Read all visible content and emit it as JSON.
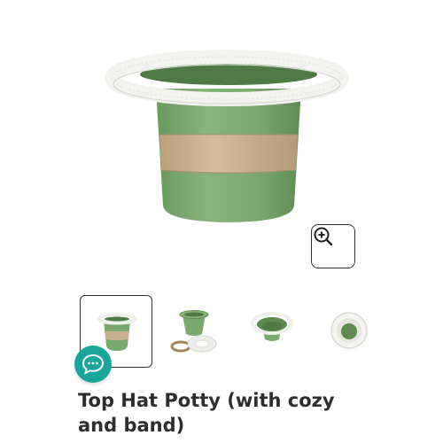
{
  "product": {
    "title": "Top Hat Potty (with cozy and band)",
    "image_alt": "Top Hat Potty with white cozy and tan band"
  },
  "gallery": {
    "selected_index": 0,
    "thumbnails": [
      {
        "alt": "Top Hat Potty front view"
      },
      {
        "alt": "Potty with band and cozy"
      },
      {
        "alt": "Potty angled view"
      },
      {
        "alt": "Potty top view"
      }
    ]
  },
  "icons": {
    "zoom": "zoom-in-icon",
    "chat": "chat-bubble-icon"
  },
  "colors": {
    "potty_green": "#78a86b",
    "band_tan": "#c9b28f",
    "cozy_white": "#f2f2ee",
    "chat_teal": "#1aa59c",
    "title_text": "#2d2d2d"
  }
}
